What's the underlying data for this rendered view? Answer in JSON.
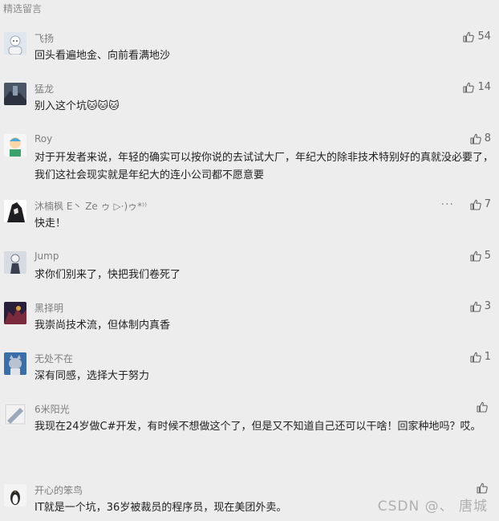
{
  "section": {
    "title": "精选留言"
  },
  "comments": [
    {
      "user": "飞扬",
      "text": "回头看遍地金、向前看满地沙",
      "likes": "54",
      "avatar_icon": "cartoon-avatar-icon"
    },
    {
      "user": "猛龙",
      "text": "别入这个坑🐱🐱🐱",
      "likes": "14",
      "avatar_icon": "photo-avatar-icon"
    },
    {
      "user": "Roy",
      "text": "对于开发者来说，年轻的确实可以按你说的去试试大厂，年纪大的除非技术特别好的真就没必要了，我们这社会现实就是年纪大的连小公司都不愿意要",
      "likes": "8",
      "avatar_icon": "cartoon-avatar-icon"
    },
    {
      "user": "沐楠枫 E丶 Ze ゥ ▷·)ゥ*⁾⁾",
      "text": "快走！",
      "likes": "7",
      "more": "···",
      "avatar_icon": "anime-avatar-icon"
    },
    {
      "user": "Jump",
      "text": "求你们别来了，快把我们卷死了",
      "likes": "5",
      "avatar_icon": "figure-avatar-icon"
    },
    {
      "user": "黑择明",
      "text": "我崇尚技术流，但体制内真香",
      "likes": "3",
      "avatar_icon": "game-avatar-icon"
    },
    {
      "user": "无处不在",
      "text": "深有同感，选择大于努力",
      "likes": "1",
      "avatar_icon": "cartoon-cat-avatar-icon"
    },
    {
      "user": "6米阳光",
      "text": "我现在24岁做C#开发，有时候不想做这个了，但是又不知道自己还可以干啥！回家种地吗？哎。",
      "likes": "",
      "avatar_icon": "photo-avatar-icon"
    },
    {
      "user": "开心的笨鸟",
      "text": "IT就是一个坑，36岁被裁员的程序员，现在美团外卖。",
      "likes": "",
      "avatar_icon": "penguin-avatar-icon"
    }
  ],
  "watermark": "CSDN @、 唐城",
  "colors": {
    "background": "#ededed",
    "username": "#7e7e7e",
    "text": "#222222",
    "like": "#666666"
  }
}
